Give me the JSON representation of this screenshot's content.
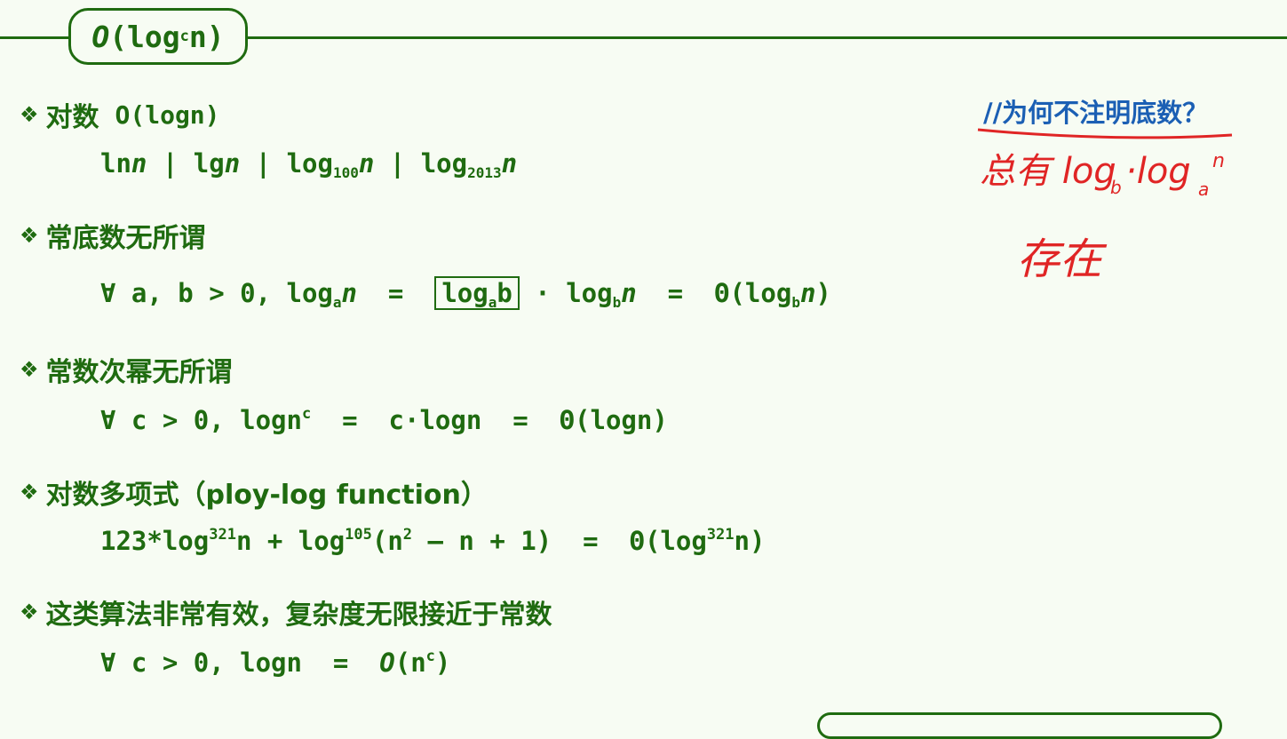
{
  "title": {
    "O": "O",
    "pre": "(log",
    "sup": "c",
    "post": "n)"
  },
  "bullets": [
    {
      "label": "对数",
      "math": "O(logn)"
    },
    {
      "label": "常底数无所谓"
    },
    {
      "label": "常数次幂无所谓"
    },
    {
      "label": "对数多项式（ploy-log function）"
    },
    {
      "label": "这类算法非常有效，复杂度无限接近于常数"
    }
  ],
  "f1": {
    "t1": "ln",
    "n": "n",
    "sep": " | ",
    "t2": "lg",
    "t3": "log",
    "s3": "100",
    "t4": "log",
    "s4": "2013"
  },
  "f2": {
    "p1": "∀ a, b > 0, log",
    "a": "a",
    "eq": "  =  ",
    "boxlog": "log",
    "boxa": "a",
    "boxb": "b",
    "dot": " · log",
    "b1": "b",
    "eq2": "  =  Θ(log",
    "b2": "b",
    "close": ")"
  },
  "f3": {
    "p1": "∀ c > 0, logn",
    "c": "c",
    "p2": "  =  c·logn  =  Θ(logn)"
  },
  "f4": {
    "p1": "123*log",
    "s1": "321",
    "p2": "n + log",
    "s2": "105",
    "p3": "(n",
    "s3": "2",
    "p4": " – n + 1)  =  Θ(log",
    "s4": "321",
    "p5": "n)"
  },
  "f5": {
    "p1": "∀ c > 0, logn  =  ",
    "O": "O",
    "p2": "(n",
    "c": "c",
    "p3": ")"
  },
  "note": "//为何不注明底数？",
  "handwriting": {
    "line1": "总有 log",
    "line1b": "b",
    "line1c": "·log",
    "line1d": "a",
    "line1e": "n",
    "line2": "存在"
  },
  "colors": {
    "text": "#1f6b10",
    "note": "#1b5fb4",
    "ink": "#e02525",
    "background": "#f7fcf3"
  }
}
